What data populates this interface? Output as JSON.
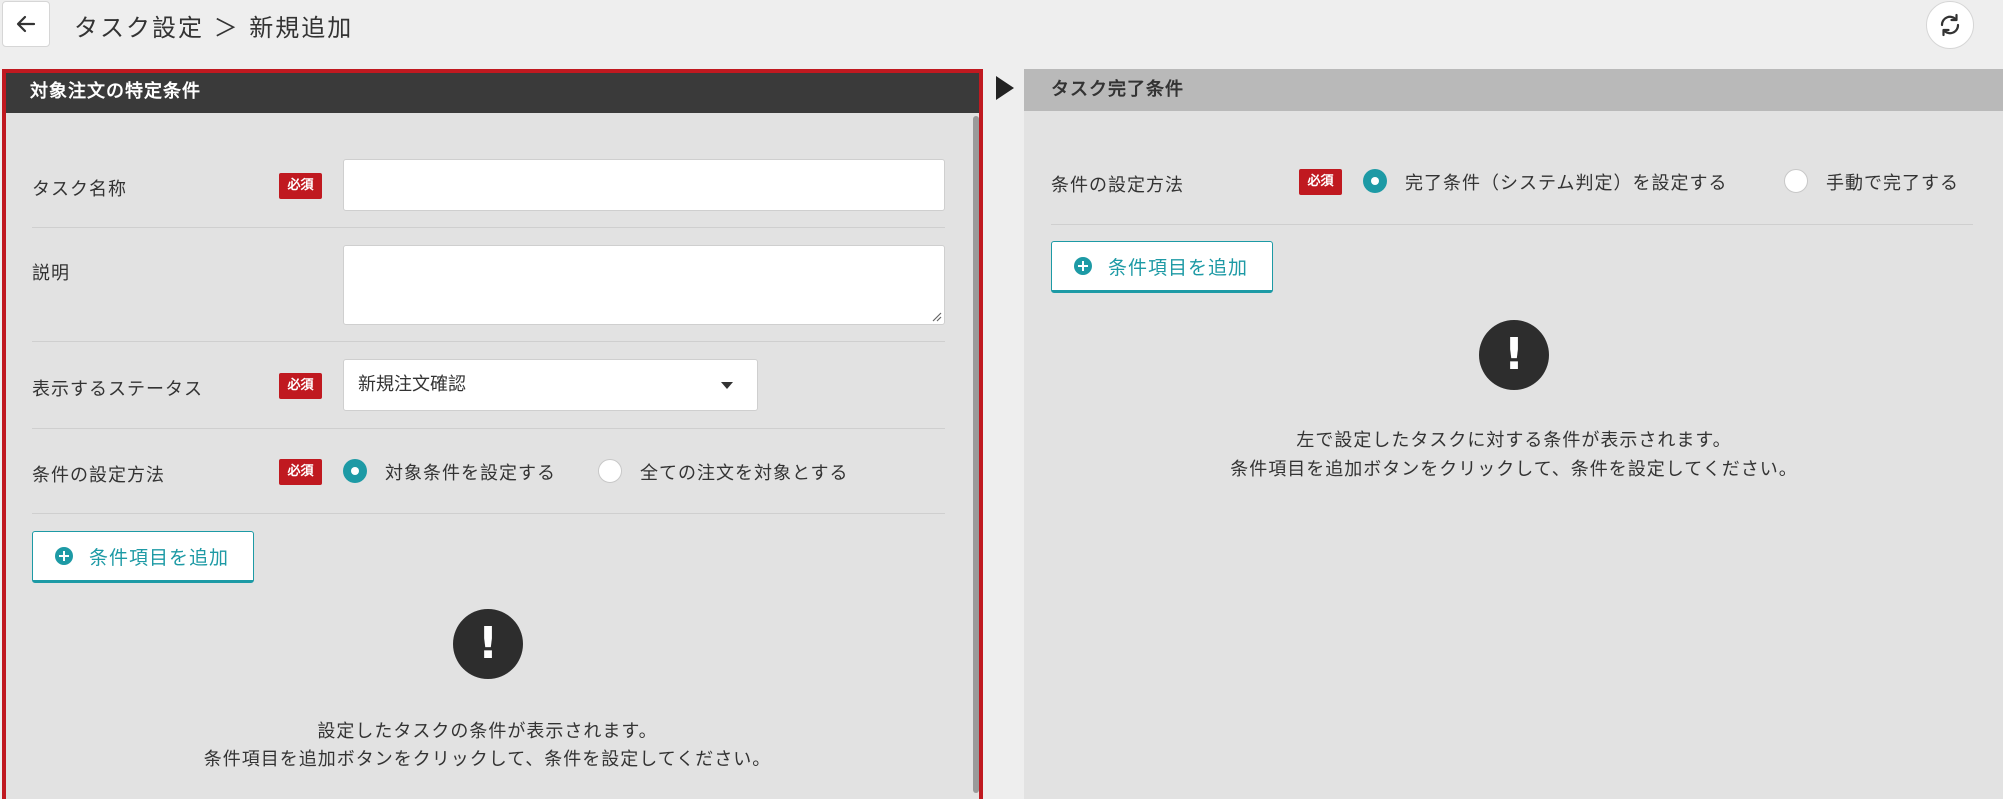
{
  "header": {
    "title": "タスク設定 ＞ 新規追加"
  },
  "left_panel": {
    "title": "対象注文の特定条件",
    "task_name": {
      "label": "タスク名称",
      "required": "必須",
      "value": ""
    },
    "description": {
      "label": "説明",
      "value": ""
    },
    "status": {
      "label": "表示するステータス",
      "required": "必須",
      "selected": "新規注文確認"
    },
    "condition_method": {
      "label": "条件の設定方法",
      "required": "必須",
      "options": [
        {
          "label": "対象条件を設定する",
          "checked": true
        },
        {
          "label": "全ての注文を対象とする",
          "checked": false
        }
      ]
    },
    "add_button": "条件項目を追加",
    "message_line1": "設定したタスクの条件が表示されます。",
    "message_line2": "条件項目を追加ボタンをクリックして、条件を設定してください。"
  },
  "right_panel": {
    "title": "タスク完了条件",
    "condition_method": {
      "label": "条件の設定方法",
      "required": "必須",
      "options": [
        {
          "label": "完了条件（システム判定）を設定する",
          "checked": true
        },
        {
          "label": "手動で完了する",
          "checked": false
        }
      ]
    },
    "add_button": "条件項目を追加",
    "message_line1": "左で設定したタスクに対する条件が表示されます。",
    "message_line2": "条件項目を追加ボタンをクリックして、条件を設定してください。"
  },
  "icons": {
    "back": "arrow-left-icon",
    "refresh": "refresh-icon",
    "add": "plus-circle-icon",
    "alert": "exclamation-icon"
  },
  "colors": {
    "accent": "#1d9aa5",
    "required": "#c01920",
    "highlight_border": "#c01920"
  }
}
